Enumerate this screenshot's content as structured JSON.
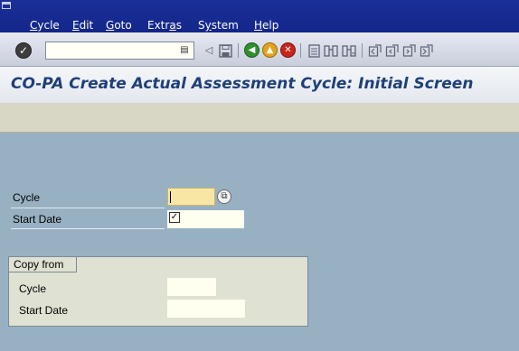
{
  "menu": {
    "items": [
      {
        "pre": "",
        "hot": "C",
        "post": "ycle"
      },
      {
        "pre": "",
        "hot": "E",
        "post": "dit"
      },
      {
        "pre": "",
        "hot": "G",
        "post": "oto"
      },
      {
        "pre": "Extr",
        "hot": "a",
        "post": "s"
      },
      {
        "pre": "S",
        "hot": "y",
        "post": "stem"
      },
      {
        "pre": "",
        "hot": "H",
        "post": "elp"
      }
    ]
  },
  "toolbar": {
    "command_value": "",
    "icons": [
      "enter-icon",
      "command-dropdown-icon",
      "back-triangle-icon",
      "save-icon",
      "back-icon",
      "exit-icon",
      "cancel-icon",
      "print-icon",
      "find-icon",
      "find-next-icon",
      "first-page-icon",
      "previous-page-icon",
      "next-page-icon",
      "last-page-icon"
    ]
  },
  "title": "CO-PA Create Actual Assessment Cycle: Initial Screen",
  "form": {
    "cycle_label": "Cycle",
    "cycle_value": "",
    "start_date_label": "Start Date",
    "start_date_value": ""
  },
  "copy_from": {
    "title": "Copy from",
    "cycle_label": "Cycle",
    "cycle_value": "",
    "start_date_label": "Start Date",
    "start_date_value": ""
  },
  "colors": {
    "menubar": "#1a2f99",
    "title_text": "#1f3f79",
    "work_area": "#97b1c2",
    "required_field": "#f7e6a4"
  }
}
